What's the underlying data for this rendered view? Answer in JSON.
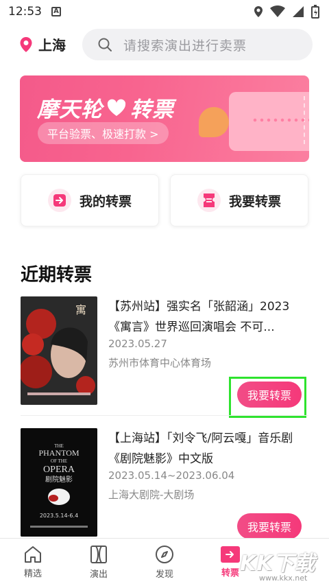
{
  "status_bar": {
    "time": "12:53",
    "badge": "A"
  },
  "header": {
    "location": "上海",
    "search_placeholder": "请搜索演出进行卖票"
  },
  "banner": {
    "title_left": "摩天轮",
    "title_right": "转票",
    "subtitle": "平台验票、极速打款 >"
  },
  "actions": [
    {
      "label": "我的转票",
      "icon": "arrow-right-icon"
    },
    {
      "label": "我要转票",
      "icon": "ticket-icon"
    }
  ],
  "section": {
    "title": "近期转票"
  },
  "items": [
    {
      "title": "【苏州站】强实名「张韶涵」2023《寓言》世界巡回演唱会 不可...",
      "date": "2023.05.27",
      "venue": "苏州市体育中心体育场",
      "button": "我要转票"
    },
    {
      "title": "【上海站】「刘令飞/阿云嘎」音乐剧《剧院魅影》中文版",
      "date": "2023.05.14~2023.06.04",
      "venue": "上海大剧院-大剧场",
      "button": "我要转票"
    }
  ],
  "poster2": {
    "line1": "THE",
    "line2": "PHANTOM",
    "line3": "OF THE",
    "line4": "OPERA",
    "line5": "剧院魅影",
    "dates": "2023.5.14-6.4"
  },
  "bottom_nav": [
    {
      "label": "精选",
      "icon": "home-icon",
      "active": false
    },
    {
      "label": "演出",
      "icon": "show-icon",
      "active": false
    },
    {
      "label": "发现",
      "icon": "compass-icon",
      "active": false
    },
    {
      "label": "转票",
      "icon": "transfer-icon",
      "active": true
    }
  ],
  "watermark": {
    "main": "KK下载",
    "sub": "www.kkx.net"
  },
  "colors": {
    "accent": "#f5397a",
    "highlight": "#2ee32e"
  }
}
